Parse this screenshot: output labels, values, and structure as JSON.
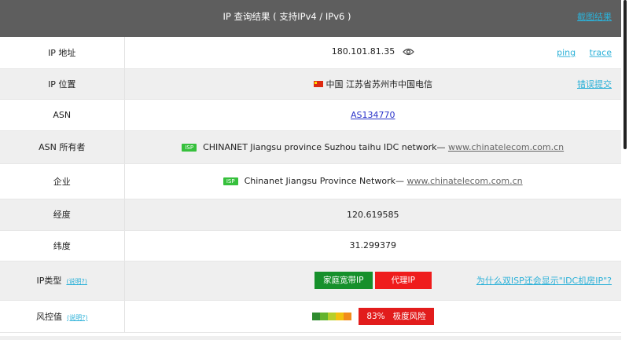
{
  "header": {
    "title": "IP 查询结果 ( 支持IPv4 / IPv6 )",
    "screenshot_link": "截图结果"
  },
  "rows": {
    "ip_address": {
      "label": "IP 地址",
      "value": "180.101.81.35",
      "ping": "ping",
      "trace": "trace"
    },
    "ip_location": {
      "label": "IP 位置",
      "value": "中国 江苏省苏州市中国电信",
      "report": "错误提交"
    },
    "asn": {
      "label": "ASN",
      "value": "AS134770"
    },
    "asn_owner": {
      "label": "ASN 所有者",
      "badge": "ISP",
      "value": "CHINANET Jiangsu province Suzhou taihu IDC network— ",
      "link": "www.chinatelecom.com.cn"
    },
    "enterprise": {
      "label": "企业",
      "badge": "ISP",
      "value": "Chinanet Jiangsu Province Network— ",
      "link": "www.chinatelecom.com.cn"
    },
    "longitude": {
      "label": "经度",
      "value": "120.619585"
    },
    "latitude": {
      "label": "纬度",
      "value": "31.299379"
    },
    "ip_type": {
      "label": "IP类型",
      "help": "(说明?)",
      "tag_home": "家庭宽带IP",
      "tag_proxy": "代理IP",
      "question": "为什么双ISP还会显示\"IDC机房IP\"?"
    },
    "risk": {
      "label": "风控值",
      "help": "(说明?)",
      "score": "83%",
      "level": "极度风险"
    }
  },
  "colors": {
    "header_bg": "#5e5e5e",
    "link": "#2cb1d8",
    "green": "#16902b",
    "red": "#ef1c1c",
    "risk_scale": [
      "#2e8b2e",
      "#63b32e",
      "#b7cf2a",
      "#f2c10f",
      "#f28c1b"
    ]
  }
}
